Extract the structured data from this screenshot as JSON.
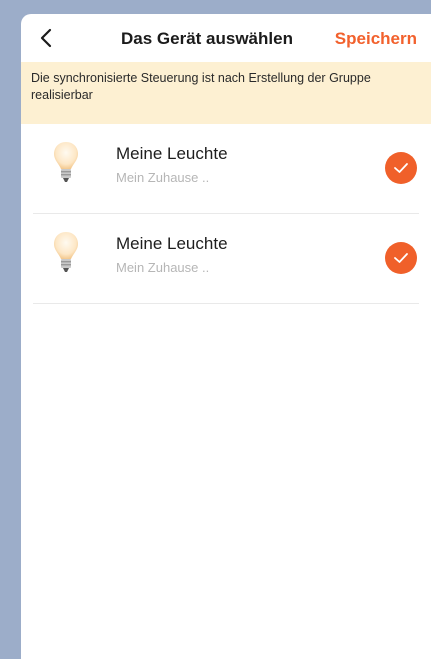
{
  "header": {
    "back_icon": "chevron-left-icon",
    "title": "Das Gerät auswählen",
    "save_label": "Speichern"
  },
  "notice": {
    "text": "Die synchronisierte Steuerung ist nach Erstellung der Gruppe realisierbar"
  },
  "devices": [
    {
      "icon": "light-bulb-icon",
      "name": "Meine Leuchte",
      "location": "Mein Zuhause ..",
      "selected": true
    },
    {
      "icon": "light-bulb-icon",
      "name": "Meine Leuchte",
      "location": "Mein Zuhause ..",
      "selected": true
    }
  ],
  "colors": {
    "accent": "#f0602a",
    "notice_bg": "#fdf0d2",
    "page_bg": "#9cadc9"
  }
}
